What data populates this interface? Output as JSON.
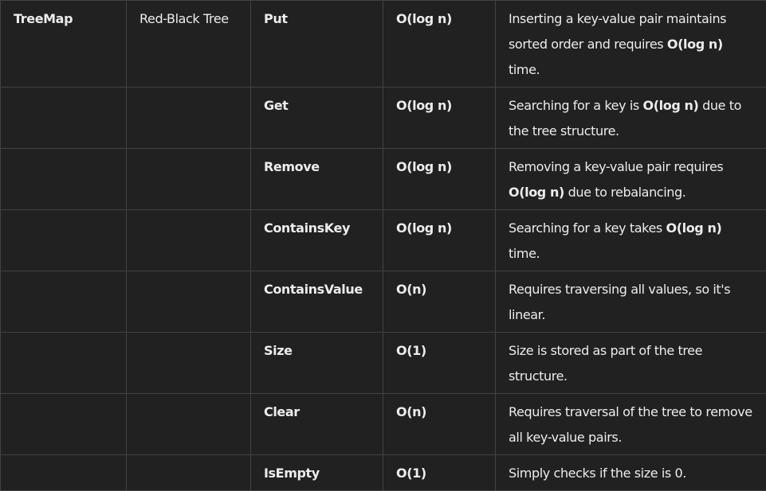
{
  "table": {
    "rows": [
      {
        "class": "TreeMap",
        "impl": "Red-Black Tree",
        "op": "Put",
        "complexity": "O(log n)",
        "desc": [
          {
            "t": "Inserting a key-value pair maintains sorted order and requires ",
            "b": false
          },
          {
            "t": "O(log n)",
            "b": true
          },
          {
            "t": " time.",
            "b": false
          }
        ]
      },
      {
        "class": "",
        "impl": "",
        "op": "Get",
        "complexity": "O(log n)",
        "desc": [
          {
            "t": "Searching for a key is ",
            "b": false
          },
          {
            "t": "O(log n)",
            "b": true
          },
          {
            "t": " due to the tree structure.",
            "b": false
          }
        ]
      },
      {
        "class": "",
        "impl": "",
        "op": "Remove",
        "complexity": "O(log n)",
        "desc": [
          {
            "t": "Removing a key-value pair requires ",
            "b": false
          },
          {
            "t": "O(log n)",
            "b": true
          },
          {
            "t": " due to rebalancing.",
            "b": false
          }
        ]
      },
      {
        "class": "",
        "impl": "",
        "op": "ContainsKey",
        "complexity": "O(log n)",
        "desc": [
          {
            "t": "Searching for a key takes ",
            "b": false
          },
          {
            "t": "O(log n)",
            "b": true
          },
          {
            "t": " time.",
            "b": false
          }
        ]
      },
      {
        "class": "",
        "impl": "",
        "op": "ContainsValue",
        "complexity": "O(n)",
        "desc": [
          {
            "t": "Requires traversing all values, so it's linear.",
            "b": false
          }
        ]
      },
      {
        "class": "",
        "impl": "",
        "op": "Size",
        "complexity": "O(1)",
        "desc": [
          {
            "t": "Size is stored as part of the tree structure.",
            "b": false
          }
        ]
      },
      {
        "class": "",
        "impl": "",
        "op": "Clear",
        "complexity": "O(n)",
        "desc": [
          {
            "t": "Requires traversal of the tree to remove all key-value pairs.",
            "b": false
          }
        ]
      },
      {
        "class": "",
        "impl": "",
        "op": "IsEmpty",
        "complexity": "O(1)",
        "desc": [
          {
            "t": "Simply checks if the size is 0.",
            "b": false
          }
        ]
      }
    ]
  }
}
